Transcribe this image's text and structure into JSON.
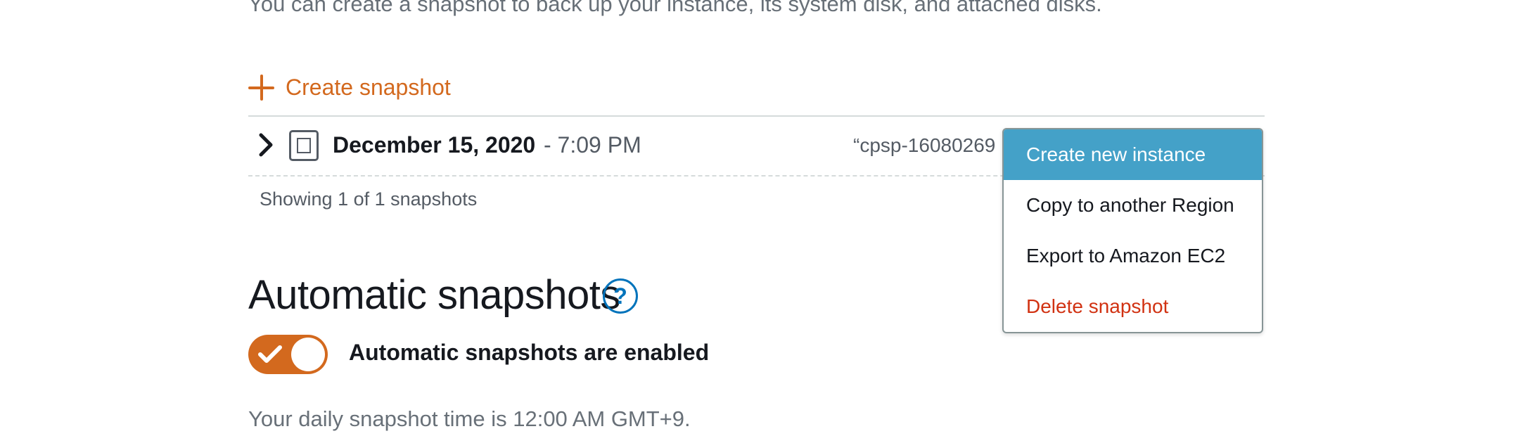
{
  "intro_text": "You can create a snapshot to back up your instance, its system disk, and attached disks.",
  "create_snapshot_label": "Create snapshot",
  "snapshot": {
    "date": "December 15, 2020",
    "time": "- 7:09 PM",
    "name": "“cpsp-16080269"
  },
  "showing_text": "Showing 1 of 1 snapshots",
  "context_menu": {
    "items": [
      {
        "label": "Create new instance"
      },
      {
        "label": "Copy to another Region"
      },
      {
        "label": "Export to Amazon EC2"
      },
      {
        "label": "Delete snapshot"
      }
    ]
  },
  "auto_snapshots": {
    "title": "Automatic snapshots",
    "help_glyph": "?",
    "toggle_label": "Automatic snapshots are enabled",
    "toggle_on": true,
    "daily_text": "Your daily snapshot time is 12:00 AM GMT+9."
  },
  "colors": {
    "accent": "#d3691e",
    "link": "#0073bb",
    "menu_highlight": "#44a1c8",
    "danger": "#d13212"
  },
  "icons": [
    "plus-icon",
    "chevron-right-icon",
    "snapshot-icon",
    "help-icon",
    "check-icon"
  ]
}
